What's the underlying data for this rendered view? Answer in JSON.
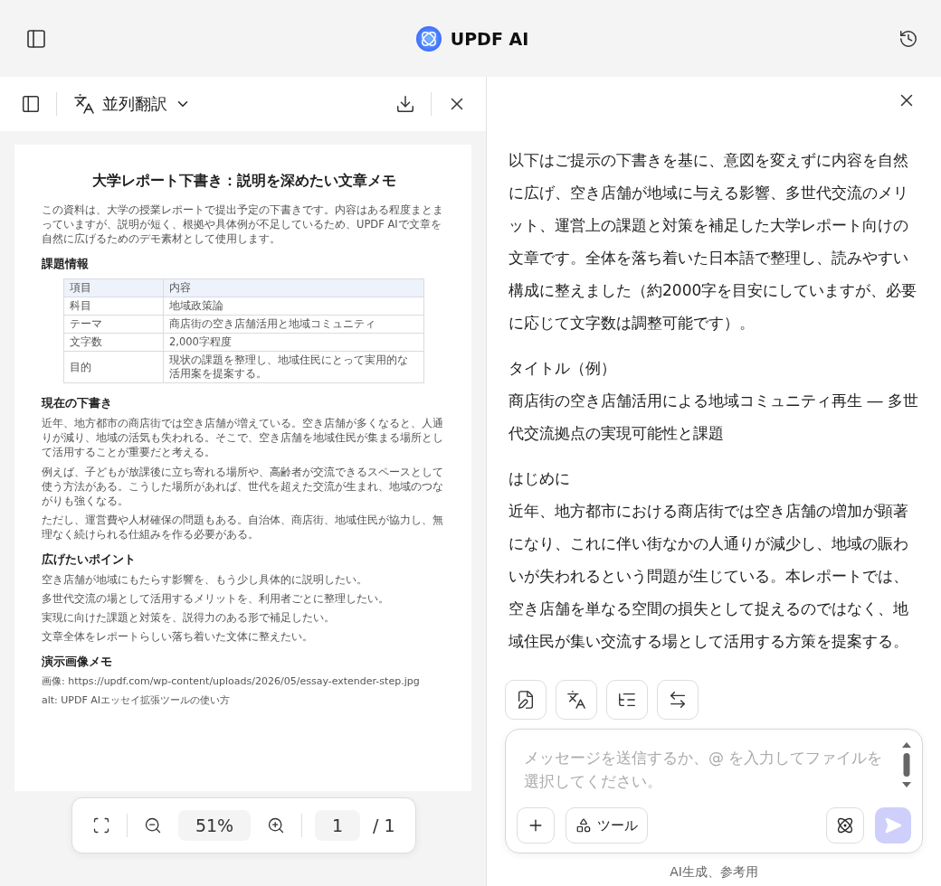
{
  "app": {
    "title": "UPDF AI"
  },
  "doc_toolbar": {
    "mode": "並列翻訳"
  },
  "document": {
    "title": "大学レポート下書き：説明を深めたい文章メモ",
    "intro": "この資料は、大学の授業レポートで提出予定の下書きです。内容はある程度まとまっていますが、説明が短く、根拠や具体例が不足しているため、UPDF AIで文章を自然に広げるためのデモ素材として使用します。",
    "sections": [
      {
        "kind": "table",
        "heading": "課題情報",
        "columns": [
          "項目",
          "内容"
        ],
        "rows": [
          [
            "科目",
            "地域政策論"
          ],
          [
            "テーマ",
            "商店街の空き店舗活用と地域コミュニティ"
          ],
          [
            "文字数",
            "2,000字程度"
          ],
          [
            "目的",
            "現状の課題を整理し、地域住民にとって実用的な活用案を提案する。"
          ]
        ]
      },
      {
        "kind": "paragraphs",
        "heading": "現在の下書き",
        "paragraphs": [
          "近年、地方都市の商店街では空き店舗が増えている。空き店舗が多くなると、人通りが減り、地域の活気も失われる。そこで、空き店舗を地域住民が集まる場所として活用することが重要だと考える。",
          "例えば、子どもが放課後に立ち寄れる場所や、高齢者が交流できるスペースとして使う方法がある。こうした場所があれば、世代を超えた交流が生まれ、地域のつながりも強くなる。",
          "ただし、運営費や人材確保の問題もある。自治体、商店街、地域住民が協力し、無理なく続けられる仕組みを作る必要がある。"
        ]
      },
      {
        "kind": "paragraphs",
        "heading": "広げたいポイント",
        "paragraphs": [
          "空き店舗が地域にもたらす影響を、もう少し具体的に説明したい。",
          "多世代交流の場として活用するメリットを、利用者ごとに整理したい。",
          "実現に向けた課題と対策を、説得力のある形で補足したい。",
          "文章全体をレポートらしい落ち着いた文体に整えたい。"
        ]
      },
      {
        "kind": "notes",
        "heading": "演示画像メモ",
        "paragraphs": [
          "画像: https://updf.com/wp-content/uploads/2026/05/essay-extender-step.jpg",
          "alt: UPDF AIエッセイ拡張ツールの使い方"
        ]
      }
    ]
  },
  "zoom_bar": {
    "zoom": "51%",
    "page": "1",
    "total": "/ 1"
  },
  "chat": {
    "blocks": [
      {
        "lines": [
          "以下はご提示の下書きを基に、意図を変えずに内容を自然に広げ、空き店舗が地域に与える影響、多世代交流のメリット、運営上の課題と対策を補足した大学レポート向けの文章です。全体を落ち着いた日本語で整理し、読みやすい構成に整えました（約2000字を目安にしていますが、必要に応じて文字数は調整可能です）。"
        ]
      },
      {
        "lines": [
          "タイトル（例）",
          "商店街の空き店舗活用による地域コミュニティ再生 ― 多世代交流拠点の実現可能性と課題"
        ]
      },
      {
        "lines": [
          "はじめに",
          "近年、地方都市における商店街では空き店舗の増加が顕著になり、これに伴い街なかの人通りが減少し、地域の賑わいが失われるという問題が生じている。本レポートでは、空き店舗を単なる空間の損失として捉えるのではなく、地域住民が集い交流する場として活用する方策を提案する。"
        ]
      }
    ]
  },
  "input": {
    "placeholder": "メッセージを送信するか、@ を入力してファイルを選択してください。"
  },
  "tools_button": "ツール",
  "send": {
    "disabled": true
  },
  "footer": "AI生成、参考用"
}
